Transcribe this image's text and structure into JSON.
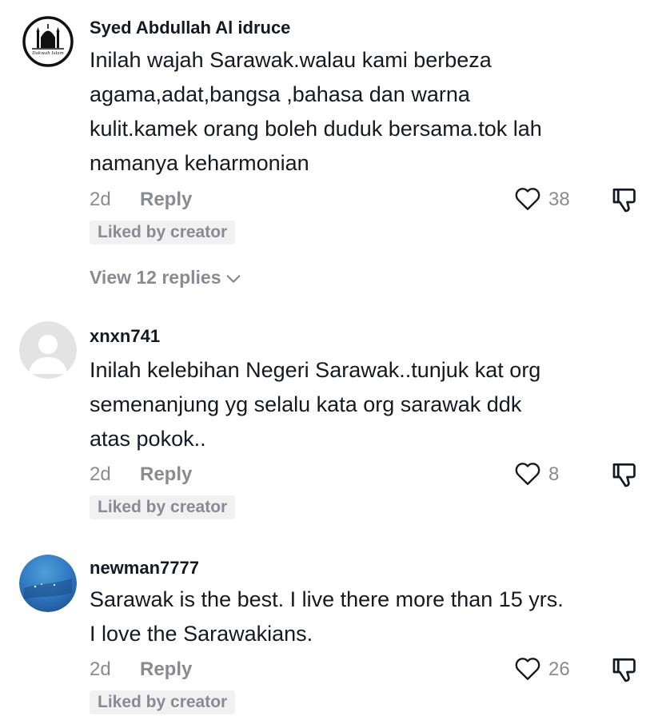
{
  "colors": {
    "text_primary": "#161823",
    "text_secondary": "#8a8b91",
    "badge_background": "#f1f1f2",
    "icon_stroke": "#161823"
  },
  "comments": [
    {
      "username": "Syed Abdullah Al idruce",
      "avatar_icon": "mosque-logo-icon",
      "avatar_caption": "Dakwah Islam",
      "text_lines": [
        "Inilah wajah Sarawak.walau kami berbeza",
        "agama,adat,bangsa ,bahasa dan warna",
        "kulit.kamek orang boleh duduk bersama.tok lah",
        "namanya keharmonian"
      ],
      "time": "2d",
      "reply_label": "Reply",
      "likes": "38",
      "badge": "Liked by creator",
      "view_replies_label": "View 12 replies"
    },
    {
      "username": "xnxn741",
      "avatar_icon": "default-avatar-icon",
      "text_lines": [
        "Inilah kelebihan Negeri Sarawak..tunjuk kat org",
        "semenanjung yg selalu kata org sarawak ddk",
        "atas pokok.."
      ],
      "time": "2d",
      "reply_label": "Reply",
      "likes": "8",
      "badge": "Liked by creator"
    },
    {
      "username": "newman7777",
      "avatar_icon": "photo-avatar-icon",
      "text_lines": [
        "Sarawak is the best. I live there more than 15 yrs.",
        "I love the Sarawakians."
      ],
      "time": "2d",
      "reply_label": "Reply",
      "likes": "26",
      "badge": "Liked by creator"
    }
  ]
}
